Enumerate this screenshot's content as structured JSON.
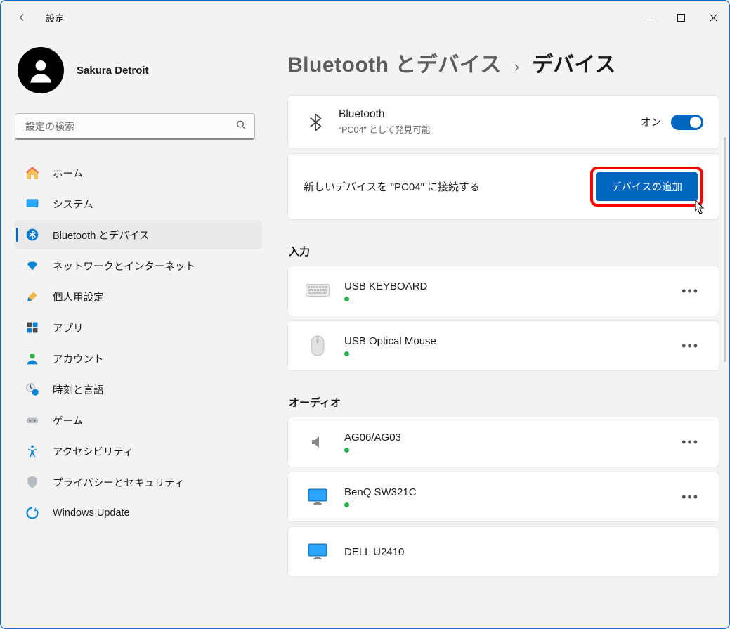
{
  "window": {
    "title": "設定"
  },
  "profile": {
    "name": "Sakura Detroit"
  },
  "search": {
    "placeholder": "設定の検索"
  },
  "sidebar": {
    "items": [
      {
        "label": "ホーム"
      },
      {
        "label": "システム"
      },
      {
        "label": "Bluetooth とデバイス"
      },
      {
        "label": "ネットワークとインターネット"
      },
      {
        "label": "個人用設定"
      },
      {
        "label": "アプリ"
      },
      {
        "label": "アカウント"
      },
      {
        "label": "時刻と言語"
      },
      {
        "label": "ゲーム"
      },
      {
        "label": "アクセシビリティ"
      },
      {
        "label": "プライバシーとセキュリティ"
      },
      {
        "label": "Windows Update"
      }
    ]
  },
  "breadcrumb": {
    "parent": "Bluetooth とデバイス",
    "current": "デバイス"
  },
  "bluetooth_card": {
    "title": "Bluetooth",
    "subtitle": "“PC04” として発見可能",
    "toggle_label": "オン",
    "toggle_state": true
  },
  "add_device_card": {
    "text": "新しいデバイスを \"PC04\" に接続する",
    "button": "デバイスの追加"
  },
  "sections": {
    "input_label": "入力",
    "audio_label": "オーディオ"
  },
  "devices": {
    "input": [
      {
        "name": "USB KEYBOARD",
        "connected": true
      },
      {
        "name": "USB Optical Mouse",
        "connected": true
      }
    ],
    "audio": [
      {
        "name": "AG06/AG03",
        "connected": true
      },
      {
        "name": "BenQ SW321C",
        "connected": true
      },
      {
        "name": "DELL U2410",
        "connected": true
      }
    ]
  }
}
